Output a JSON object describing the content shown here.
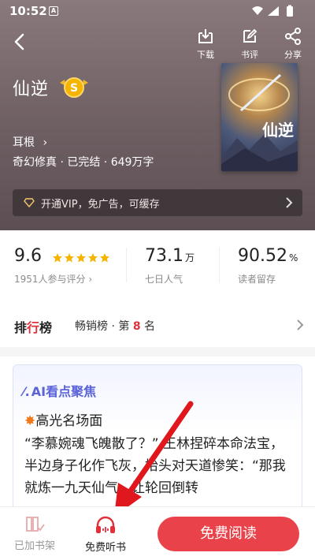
{
  "status_bar": {
    "time": "10:52",
    "sim_label": "A"
  },
  "toolbar": {
    "download": "下载",
    "review": "书评",
    "share": "分享"
  },
  "book": {
    "title": "仙逆",
    "badge": "S",
    "author": "耳根",
    "meta": "奇幻修真 · 已完结 · 649万字",
    "cover_text": "仙逆"
  },
  "vip": {
    "text": "开通VIP，免广告，可缓存"
  },
  "stats": {
    "rating": "9.6",
    "rating_stars": 5,
    "rating_sub": "1951人参与评分",
    "popularity": "73.1",
    "popularity_unit": "万",
    "popularity_sub": "七日人气",
    "retention": "90.52",
    "retention_unit": "%",
    "retention_sub": "读者留存"
  },
  "rank": {
    "label_prefix": "排",
    "label_mid": "行",
    "label_suffix": "榜",
    "list": "畅销榜 · 第",
    "position": "8",
    "suffix": "名"
  },
  "ai": {
    "title": "AI看点聚焦",
    "highlight_title": "高光名场面",
    "excerpt": "“李慕婉魂飞魄散了？” 王林捏碎本命法宝，半边身子化作飞灰，抬头对天道惨笑：“那我就炼一九天仙气，让轮回倒转"
  },
  "bottom": {
    "shelf": "已加书架",
    "listen": "免费听书",
    "read": "免费阅读"
  },
  "colors": {
    "accent_red": "#e9424a",
    "ai_blue": "#5a63d8",
    "star_gold": "#f5b400"
  }
}
